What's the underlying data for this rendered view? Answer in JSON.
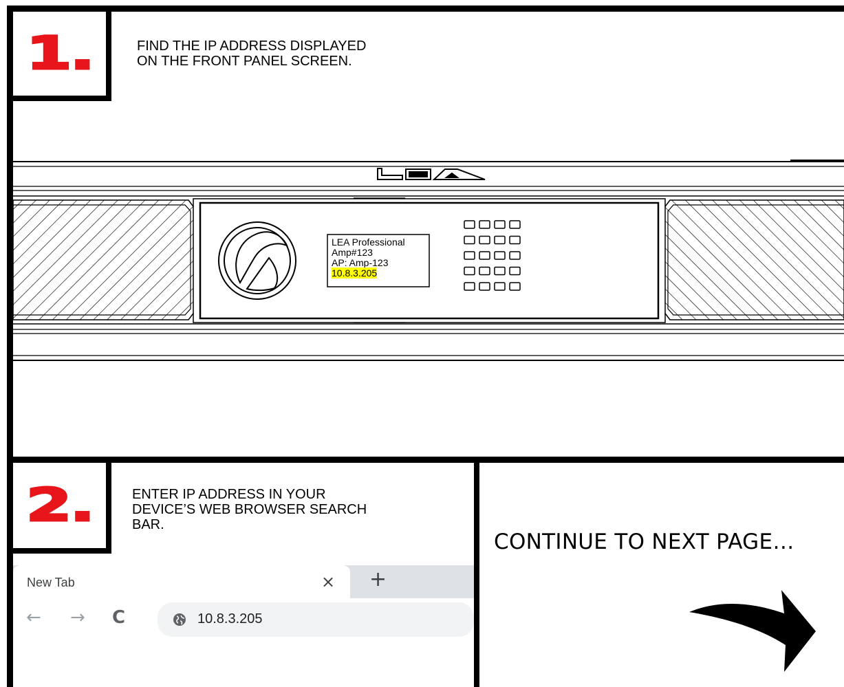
{
  "step1": {
    "number": "1.",
    "instruction": "FIND THE IP ADDRESS DISPLAYED\nON THE FRONT PANEL SCREEN."
  },
  "device": {
    "logo_text": "LEA",
    "screen_lines": [
      "LEA Professional",
      "Amp#123",
      "AP: Amp-123"
    ],
    "ip_address": "10.8.3.205",
    "button_rows": 5,
    "button_cols": 4
  },
  "step2": {
    "number": "2.",
    "instruction": "ENTER IP ADDRESS IN YOUR\nDEVICE’S WEB BROWSER SEARCH\nBAR."
  },
  "browser": {
    "tab_title": "New Tab",
    "close_glyph": "×",
    "new_tab_glyph": "+",
    "back_glyph": "←",
    "forward_glyph": "→",
    "reload_glyph": "C",
    "url": "10.8.3.205"
  },
  "continue_text": "CONTINUE TO NEXT PAGE…",
  "colors": {
    "step_number": "#e8151b",
    "highlight": "#ffff00",
    "tabstrip": "#dee1e6"
  }
}
